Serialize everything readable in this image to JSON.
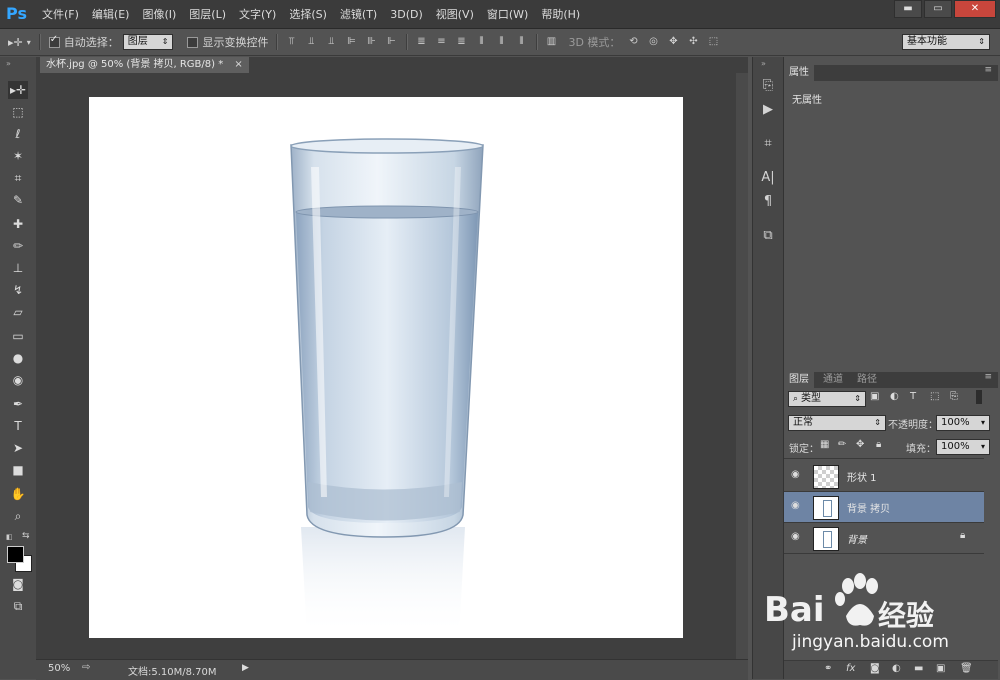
{
  "app": {
    "logo": "Ps"
  },
  "menu": {
    "items": [
      "文件(F)",
      "编辑(E)",
      "图像(I)",
      "图层(L)",
      "文字(Y)",
      "选择(S)",
      "滤镜(T)",
      "3D(D)",
      "视图(V)",
      "窗口(W)",
      "帮助(H)"
    ]
  },
  "window_controls": {
    "minimize": "▬",
    "maximize": "▭",
    "close": "✕"
  },
  "options_bar": {
    "move_icon": "▸✛",
    "auto_select_label": "自动选择：",
    "auto_select_checked": true,
    "auto_select_target": "图层",
    "show_transform_label": "显示变换控件",
    "show_transform_checked": false,
    "mode_3d_label": "3D 模式：",
    "workspace": "基本功能"
  },
  "document": {
    "tab_title": "水杯.jpg @ 50% (背景 拷贝, RGB/8) *",
    "tab_close": "×"
  },
  "status_bar": {
    "zoom": "50%",
    "doc_info": "文档:5.10M/8.70M"
  },
  "properties_panel": {
    "tab": "属性",
    "content": "无属性"
  },
  "layers_panel": {
    "tabs": [
      "图层",
      "通道",
      "路径"
    ],
    "filter_kind": "类型",
    "blend_mode": "正常",
    "opacity_label": "不透明度：",
    "opacity": "100%",
    "lock_label": "锁定：",
    "fill_label": "填充：",
    "fill": "100%",
    "layers": [
      {
        "name": "形状 1",
        "selected": false
      },
      {
        "name": "背景 拷贝",
        "selected": true
      },
      {
        "name": "背景",
        "selected": false,
        "locked": true
      }
    ],
    "footer_icons": [
      "link-icon",
      "fx-icon",
      "mask-icon",
      "adjustment-icon",
      "group-icon",
      "new-layer-icon",
      "delete-icon"
    ]
  },
  "watermark": {
    "brand": "Bai",
    "brand2": "经验",
    "url": "jingyan.baidu.com"
  },
  "colors": {
    "accent": "#34a6ff",
    "selected_layer": "#6e84a4",
    "panel": "#535353",
    "dark": "#3b3b3b"
  }
}
